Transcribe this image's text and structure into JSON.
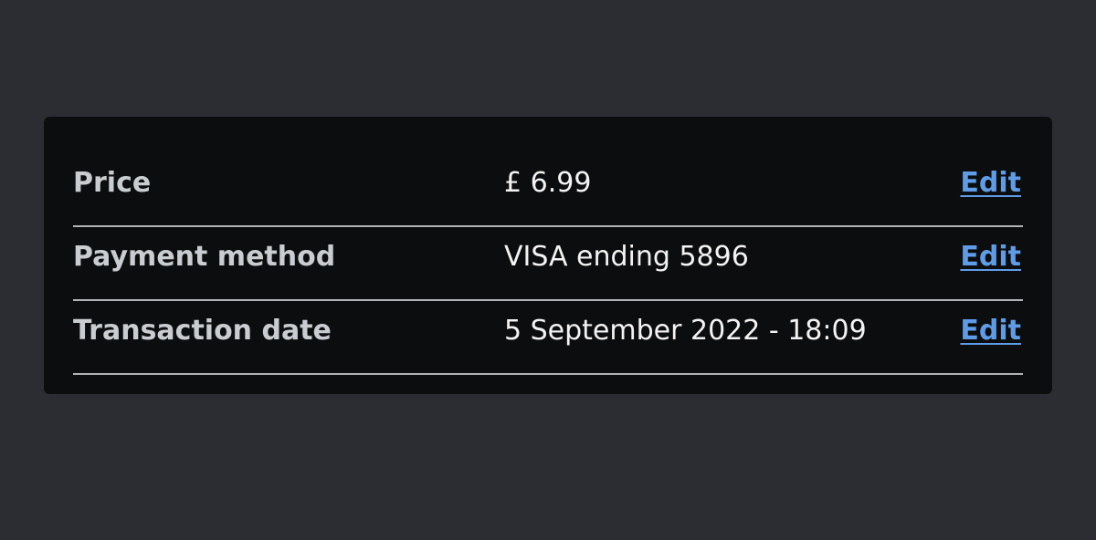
{
  "summary": {
    "rows": [
      {
        "key": "Price",
        "value": "£ 6.99",
        "action": "Edit"
      },
      {
        "key": "Payment method",
        "value": "VISA ending 5896",
        "action": "Edit"
      },
      {
        "key": "Transaction date",
        "value": "5 September 2022 - 18:09",
        "action": "Edit"
      }
    ]
  },
  "colors": {
    "page_background": "#2b2d32",
    "card_background": "#0c0d0e",
    "divider": "#b1b4b6",
    "link": "#5e9ce8"
  }
}
